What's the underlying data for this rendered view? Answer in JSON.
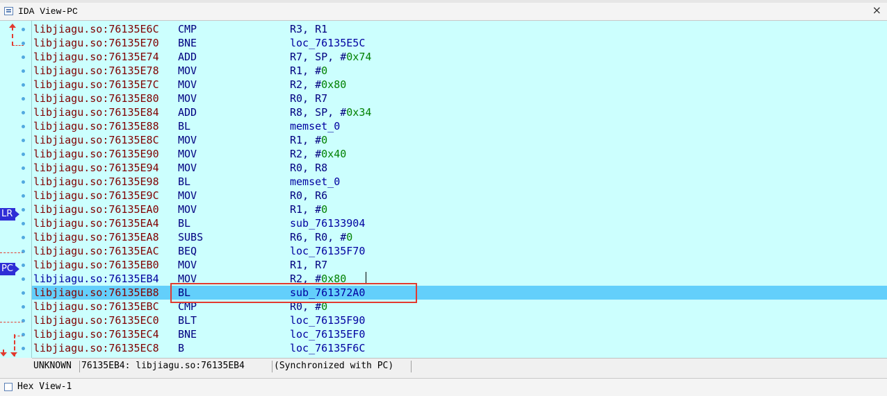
{
  "window": {
    "title": "IDA View-PC",
    "close_glyph": "×"
  },
  "rows": [
    {
      "addr": "libjiagu.so:76135E6C",
      "mn": "CMP",
      "ops": [
        {
          "t": "R3, R1",
          "k": "reg"
        }
      ]
    },
    {
      "addr": "libjiagu.so:76135E70",
      "mn": "BNE",
      "ops": [
        {
          "t": "loc_76135E5C",
          "k": "name"
        }
      ]
    },
    {
      "addr": "libjiagu.so:76135E74",
      "mn": "ADD",
      "ops": [
        {
          "t": "R7, SP, #",
          "k": "reg"
        },
        {
          "t": "0x74",
          "k": "num"
        }
      ]
    },
    {
      "addr": "libjiagu.so:76135E78",
      "mn": "MOV",
      "ops": [
        {
          "t": "R1, #",
          "k": "reg"
        },
        {
          "t": "0",
          "k": "num"
        }
      ]
    },
    {
      "addr": "libjiagu.so:76135E7C",
      "mn": "MOV",
      "ops": [
        {
          "t": "R2, #",
          "k": "reg"
        },
        {
          "t": "0x80",
          "k": "num"
        }
      ]
    },
    {
      "addr": "libjiagu.so:76135E80",
      "mn": "MOV",
      "ops": [
        {
          "t": "R0, R7",
          "k": "reg"
        }
      ]
    },
    {
      "addr": "libjiagu.so:76135E84",
      "mn": "ADD",
      "ops": [
        {
          "t": "R8, SP, #",
          "k": "reg"
        },
        {
          "t": "0x34",
          "k": "num"
        }
      ]
    },
    {
      "addr": "libjiagu.so:76135E88",
      "mn": "BL",
      "ops": [
        {
          "t": "memset_0",
          "k": "name"
        }
      ]
    },
    {
      "addr": "libjiagu.so:76135E8C",
      "mn": "MOV",
      "ops": [
        {
          "t": "R1, #",
          "k": "reg"
        },
        {
          "t": "0",
          "k": "num"
        }
      ]
    },
    {
      "addr": "libjiagu.so:76135E90",
      "mn": "MOV",
      "ops": [
        {
          "t": "R2, #",
          "k": "reg"
        },
        {
          "t": "0x40",
          "k": "num"
        }
      ]
    },
    {
      "addr": "libjiagu.so:76135E94",
      "mn": "MOV",
      "ops": [
        {
          "t": "R0, R8",
          "k": "reg"
        }
      ]
    },
    {
      "addr": "libjiagu.so:76135E98",
      "mn": "BL",
      "ops": [
        {
          "t": "memset_0",
          "k": "name"
        }
      ]
    },
    {
      "addr": "libjiagu.so:76135E9C",
      "mn": "MOV",
      "ops": [
        {
          "t": "R0, R6",
          "k": "reg"
        }
      ]
    },
    {
      "addr": "libjiagu.so:76135EA0",
      "mn": "MOV",
      "ops": [
        {
          "t": "R1, #",
          "k": "reg"
        },
        {
          "t": "0",
          "k": "num"
        }
      ]
    },
    {
      "addr": "libjiagu.so:76135EA4",
      "mn": "BL",
      "ops": [
        {
          "t": "sub_76133904",
          "k": "name"
        }
      ]
    },
    {
      "addr": "libjiagu.so:76135EA8",
      "mn": "SUBS",
      "ops": [
        {
          "t": "R6, R0, #",
          "k": "reg"
        },
        {
          "t": "0",
          "k": "num"
        }
      ]
    },
    {
      "addr": "libjiagu.so:76135EAC",
      "mn": "BEQ",
      "ops": [
        {
          "t": "loc_76135F70",
          "k": "name"
        }
      ]
    },
    {
      "addr": "libjiagu.so:76135EB0",
      "mn": "MOV",
      "ops": [
        {
          "t": "R1, R7",
          "k": "reg"
        }
      ]
    },
    {
      "addr": "libjiagu.so:76135EB4",
      "mn": "MOV",
      "ops": [
        {
          "t": "R2, #",
          "k": "reg"
        },
        {
          "t": "0x80",
          "k": "num"
        }
      ],
      "cursor": true
    },
    {
      "addr": "libjiagu.so:76135EB8",
      "mn": "BL",
      "ops": [
        {
          "t": "sub_761372A0",
          "k": "name"
        }
      ],
      "highlight": true
    },
    {
      "addr": "libjiagu.so:76135EBC",
      "mn": "CMP",
      "ops": [
        {
          "t": "R0, #",
          "k": "reg"
        },
        {
          "t": "0",
          "k": "num"
        }
      ]
    },
    {
      "addr": "libjiagu.so:76135EC0",
      "mn": "BLT",
      "ops": [
        {
          "t": "loc_76135F90",
          "k": "name"
        }
      ]
    },
    {
      "addr": "libjiagu.so:76135EC4",
      "mn": "BNE",
      "ops": [
        {
          "t": "loc_76135EF0",
          "k": "name"
        }
      ]
    },
    {
      "addr": "libjiagu.so:76135EC8",
      "mn": "B",
      "ops": [
        {
          "t": "loc_76135F6C",
          "k": "name"
        }
      ]
    }
  ],
  "markers": {
    "lr": "LR",
    "pc": "PC"
  },
  "status": {
    "mode": "UNKNOWN",
    "location": "76135EB4: libjiagu.so:76135EB4",
    "sync": "(Synchronized with PC)"
  },
  "bottom_tab": {
    "label": "Hex View-1"
  },
  "colors": {
    "background": "#ccfffe",
    "highlight": "#63cffb",
    "address": "#800000",
    "mnemonic": "#000080",
    "number": "#008000",
    "name": "#0000a0",
    "annotation": "#e23a2f"
  }
}
